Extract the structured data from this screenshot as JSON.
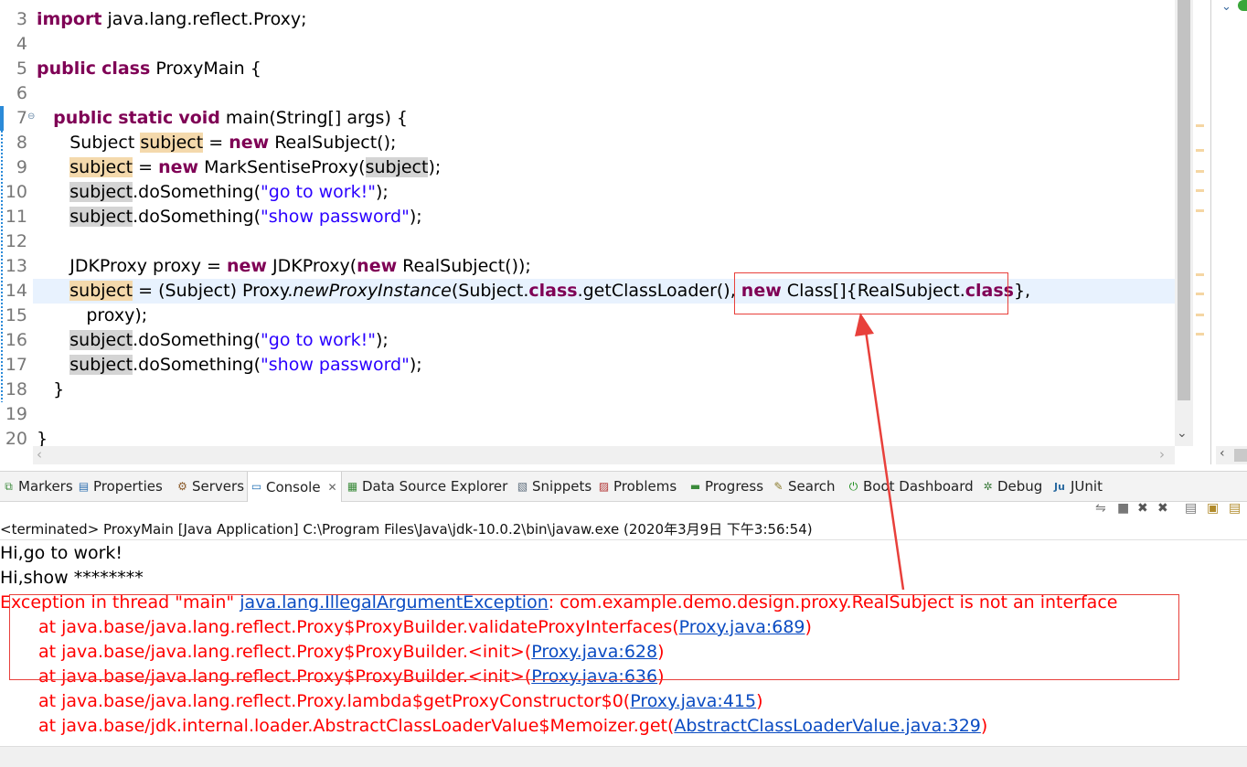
{
  "editor": {
    "lines": [
      {
        "num": "3",
        "segs": [
          [
            "kw",
            "import"
          ],
          [
            "n",
            " java.lang.reflect.Proxy;"
          ]
        ]
      },
      {
        "num": "4",
        "segs": []
      },
      {
        "num": "5",
        "segs": [
          [
            "kw",
            "public"
          ],
          [
            "n",
            " "
          ],
          [
            "kw",
            "class"
          ],
          [
            "n",
            " ProxyMain {"
          ]
        ]
      },
      {
        "num": "6",
        "segs": []
      },
      {
        "num": "7",
        "fold": "⊖",
        "segs": [
          [
            "n",
            "   "
          ],
          [
            "kw",
            "public"
          ],
          [
            "n",
            " "
          ],
          [
            "kw",
            "static"
          ],
          [
            "n",
            " "
          ],
          [
            "kw",
            "void"
          ],
          [
            "n",
            " main(String[] args) {"
          ]
        ]
      },
      {
        "num": "8",
        "segs": [
          [
            "n",
            "      Subject "
          ],
          [
            "hlw",
            "subject"
          ],
          [
            "n",
            " = "
          ],
          [
            "kw",
            "new"
          ],
          [
            "n",
            " RealSubject();"
          ]
        ]
      },
      {
        "num": "9",
        "segs": [
          [
            "n",
            "      "
          ],
          [
            "hlw",
            "subject"
          ],
          [
            "n",
            " = "
          ],
          [
            "kw",
            "new"
          ],
          [
            "n",
            " MarkSentiseProxy("
          ],
          [
            "hlr",
            "subject"
          ],
          [
            "n",
            ");"
          ]
        ]
      },
      {
        "num": "10",
        "segs": [
          [
            "n",
            "      "
          ],
          [
            "hlr",
            "subject"
          ],
          [
            "n",
            ".doSomething("
          ],
          [
            "str",
            "\"go to work!\""
          ],
          [
            "n",
            ");"
          ]
        ]
      },
      {
        "num": "11",
        "segs": [
          [
            "n",
            "      "
          ],
          [
            "hlr",
            "subject"
          ],
          [
            "n",
            ".doSomething("
          ],
          [
            "str",
            "\"show password\""
          ],
          [
            "n",
            ");"
          ]
        ]
      },
      {
        "num": "12",
        "segs": []
      },
      {
        "num": "13",
        "segs": [
          [
            "n",
            "      JDKProxy proxy = "
          ],
          [
            "kw",
            "new"
          ],
          [
            "n",
            " JDKProxy("
          ],
          [
            "kw",
            "new"
          ],
          [
            "n",
            " RealSubject());"
          ]
        ]
      },
      {
        "num": "14",
        "segs": [
          [
            "n",
            "      "
          ],
          [
            "hlw",
            "subject"
          ],
          [
            "n",
            " = (Subject) Proxy."
          ],
          [
            "it",
            "newProxyInstance"
          ],
          [
            "n",
            "(Subject."
          ],
          [
            "kw",
            "class"
          ],
          [
            "n",
            ".getClassLoader(), "
          ],
          [
            "kw",
            "new"
          ],
          [
            "n",
            " Class[]{RealSubject."
          ],
          [
            "kw",
            "class"
          ],
          [
            "n",
            "},"
          ]
        ]
      },
      {
        "num": "15",
        "segs": [
          [
            "n",
            "         proxy);"
          ]
        ]
      },
      {
        "num": "16",
        "segs": [
          [
            "n",
            "      "
          ],
          [
            "hlr",
            "subject"
          ],
          [
            "n",
            ".doSomething("
          ],
          [
            "str",
            "\"go to work!\""
          ],
          [
            "n",
            ");"
          ]
        ]
      },
      {
        "num": "17",
        "segs": [
          [
            "n",
            "      "
          ],
          [
            "hlr",
            "subject"
          ],
          [
            "n",
            ".doSomething("
          ],
          [
            "str",
            "\"show password\""
          ],
          [
            "n",
            ");"
          ]
        ]
      },
      {
        "num": "18",
        "segs": [
          [
            "n",
            "   }"
          ]
        ]
      },
      {
        "num": "19",
        "segs": []
      },
      {
        "num": "20",
        "segs": [
          [
            "n",
            "}"
          ]
        ]
      }
    ]
  },
  "tabs": [
    {
      "label": "Markers",
      "icon": "markers-icon",
      "glyph": "⧉"
    },
    {
      "label": "Properties",
      "icon": "properties-icon",
      "glyph": "▤"
    },
    {
      "label": "Servers",
      "icon": "servers-icon",
      "glyph": "⚙"
    },
    {
      "label": "Console",
      "icon": "console-icon",
      "glyph": "▭",
      "active": true
    },
    {
      "label": "Data Source Explorer",
      "icon": "data-source-icon",
      "glyph": "▦"
    },
    {
      "label": "Snippets",
      "icon": "snippets-icon",
      "glyph": "▧"
    },
    {
      "label": "Problems",
      "icon": "problems-icon",
      "glyph": "▨"
    },
    {
      "label": "Progress",
      "icon": "progress-icon",
      "glyph": "▬"
    },
    {
      "label": "Search",
      "icon": "search-icon",
      "glyph": "✎"
    },
    {
      "label": "Boot Dashboard",
      "icon": "boot-dashboard-icon",
      "glyph": "⏻"
    },
    {
      "label": "Debug",
      "icon": "debug-icon",
      "glyph": "✲"
    },
    {
      "label": "JUnit",
      "icon": "junit-icon",
      "glyph": "Ju"
    }
  ],
  "console": {
    "header": "<terminated> ProxyMain [Java Application] C:\\Program Files\\Java\\jdk-10.0.2\\bin\\javaw.exe (2020年3月9日 下午3:56:54)",
    "lines": [
      {
        "segs": [
          [
            "b",
            "Hi,go to work!"
          ]
        ]
      },
      {
        "segs": [
          [
            "b",
            "Hi,show ********"
          ]
        ]
      },
      {
        "segs": [
          [
            "r",
            "Exception in thread \"main\" "
          ],
          [
            "l",
            "java.lang.IllegalArgumentException"
          ],
          [
            "r",
            ": com.example.demo.design.proxy.RealSubject is not an interface"
          ]
        ]
      },
      {
        "segs": [
          [
            "r",
            "\tat java.base/java.lang.reflect.Proxy$ProxyBuilder.validateProxyInterfaces("
          ],
          [
            "l",
            "Proxy.java:689"
          ],
          [
            "r",
            ")"
          ]
        ]
      },
      {
        "segs": [
          [
            "r",
            "\tat java.base/java.lang.reflect.Proxy$ProxyBuilder.<init>("
          ],
          [
            "l",
            "Proxy.java:628"
          ],
          [
            "r",
            ")"
          ]
        ]
      },
      {
        "segs": [
          [
            "r",
            "\tat java.base/java.lang.reflect.Proxy$ProxyBuilder.<init>("
          ],
          [
            "l",
            "Proxy.java:636"
          ],
          [
            "r",
            ")"
          ]
        ]
      },
      {
        "segs": [
          [
            "r",
            "\tat java.base/java.lang.reflect.Proxy.lambda$getProxyConstructor$0("
          ],
          [
            "l",
            "Proxy.java:415"
          ],
          [
            "r",
            ")"
          ]
        ]
      },
      {
        "segs": [
          [
            "r",
            "\tat java.base/jdk.internal.loader.AbstractClassLoaderValue$Memoizer.get("
          ],
          [
            "l",
            "AbstractClassLoaderValue.java:329"
          ],
          [
            "r",
            ")"
          ]
        ]
      }
    ]
  },
  "colors": {
    "keyword": "#7f0055",
    "string": "#2a00ff",
    "error": "#ff0000",
    "link": "#0a4bc2",
    "annotation": "#e8403b"
  }
}
